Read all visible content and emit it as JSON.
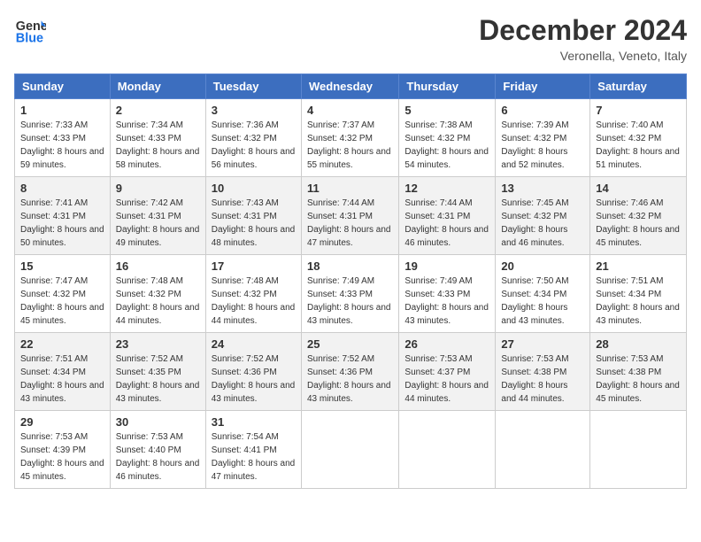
{
  "header": {
    "logo_line1": "General",
    "logo_line2": "Blue",
    "month": "December 2024",
    "location": "Veronella, Veneto, Italy"
  },
  "weekdays": [
    "Sunday",
    "Monday",
    "Tuesday",
    "Wednesday",
    "Thursday",
    "Friday",
    "Saturday"
  ],
  "weeks": [
    [
      {
        "day": "1",
        "sunrise": "7:33 AM",
        "sunset": "4:33 PM",
        "daylight": "8 hours and 59 minutes."
      },
      {
        "day": "2",
        "sunrise": "7:34 AM",
        "sunset": "4:33 PM",
        "daylight": "8 hours and 58 minutes."
      },
      {
        "day": "3",
        "sunrise": "7:36 AM",
        "sunset": "4:32 PM",
        "daylight": "8 hours and 56 minutes."
      },
      {
        "day": "4",
        "sunrise": "7:37 AM",
        "sunset": "4:32 PM",
        "daylight": "8 hours and 55 minutes."
      },
      {
        "day": "5",
        "sunrise": "7:38 AM",
        "sunset": "4:32 PM",
        "daylight": "8 hours and 54 minutes."
      },
      {
        "day": "6",
        "sunrise": "7:39 AM",
        "sunset": "4:32 PM",
        "daylight": "8 hours and 52 minutes."
      },
      {
        "day": "7",
        "sunrise": "7:40 AM",
        "sunset": "4:32 PM",
        "daylight": "8 hours and 51 minutes."
      }
    ],
    [
      {
        "day": "8",
        "sunrise": "7:41 AM",
        "sunset": "4:31 PM",
        "daylight": "8 hours and 50 minutes."
      },
      {
        "day": "9",
        "sunrise": "7:42 AM",
        "sunset": "4:31 PM",
        "daylight": "8 hours and 49 minutes."
      },
      {
        "day": "10",
        "sunrise": "7:43 AM",
        "sunset": "4:31 PM",
        "daylight": "8 hours and 48 minutes."
      },
      {
        "day": "11",
        "sunrise": "7:44 AM",
        "sunset": "4:31 PM",
        "daylight": "8 hours and 47 minutes."
      },
      {
        "day": "12",
        "sunrise": "7:44 AM",
        "sunset": "4:31 PM",
        "daylight": "8 hours and 46 minutes."
      },
      {
        "day": "13",
        "sunrise": "7:45 AM",
        "sunset": "4:32 PM",
        "daylight": "8 hours and 46 minutes."
      },
      {
        "day": "14",
        "sunrise": "7:46 AM",
        "sunset": "4:32 PM",
        "daylight": "8 hours and 45 minutes."
      }
    ],
    [
      {
        "day": "15",
        "sunrise": "7:47 AM",
        "sunset": "4:32 PM",
        "daylight": "8 hours and 45 minutes."
      },
      {
        "day": "16",
        "sunrise": "7:48 AM",
        "sunset": "4:32 PM",
        "daylight": "8 hours and 44 minutes."
      },
      {
        "day": "17",
        "sunrise": "7:48 AM",
        "sunset": "4:32 PM",
        "daylight": "8 hours and 44 minutes."
      },
      {
        "day": "18",
        "sunrise": "7:49 AM",
        "sunset": "4:33 PM",
        "daylight": "8 hours and 43 minutes."
      },
      {
        "day": "19",
        "sunrise": "7:49 AM",
        "sunset": "4:33 PM",
        "daylight": "8 hours and 43 minutes."
      },
      {
        "day": "20",
        "sunrise": "7:50 AM",
        "sunset": "4:34 PM",
        "daylight": "8 hours and 43 minutes."
      },
      {
        "day": "21",
        "sunrise": "7:51 AM",
        "sunset": "4:34 PM",
        "daylight": "8 hours and 43 minutes."
      }
    ],
    [
      {
        "day": "22",
        "sunrise": "7:51 AM",
        "sunset": "4:34 PM",
        "daylight": "8 hours and 43 minutes."
      },
      {
        "day": "23",
        "sunrise": "7:52 AM",
        "sunset": "4:35 PM",
        "daylight": "8 hours and 43 minutes."
      },
      {
        "day": "24",
        "sunrise": "7:52 AM",
        "sunset": "4:36 PM",
        "daylight": "8 hours and 43 minutes."
      },
      {
        "day": "25",
        "sunrise": "7:52 AM",
        "sunset": "4:36 PM",
        "daylight": "8 hours and 43 minutes."
      },
      {
        "day": "26",
        "sunrise": "7:53 AM",
        "sunset": "4:37 PM",
        "daylight": "8 hours and 44 minutes."
      },
      {
        "day": "27",
        "sunrise": "7:53 AM",
        "sunset": "4:38 PM",
        "daylight": "8 hours and 44 minutes."
      },
      {
        "day": "28",
        "sunrise": "7:53 AM",
        "sunset": "4:38 PM",
        "daylight": "8 hours and 45 minutes."
      }
    ],
    [
      {
        "day": "29",
        "sunrise": "7:53 AM",
        "sunset": "4:39 PM",
        "daylight": "8 hours and 45 minutes."
      },
      {
        "day": "30",
        "sunrise": "7:53 AM",
        "sunset": "4:40 PM",
        "daylight": "8 hours and 46 minutes."
      },
      {
        "day": "31",
        "sunrise": "7:54 AM",
        "sunset": "4:41 PM",
        "daylight": "8 hours and 47 minutes."
      },
      null,
      null,
      null,
      null
    ]
  ]
}
